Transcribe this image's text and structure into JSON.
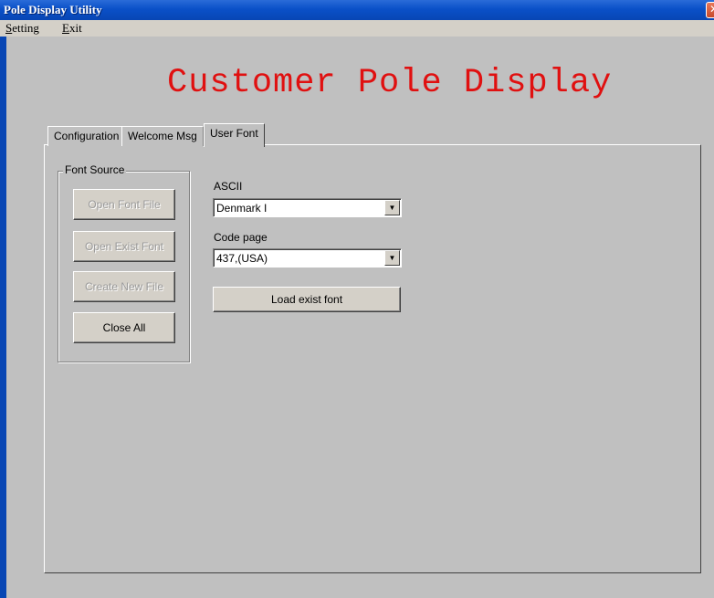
{
  "window": {
    "title": "Pole Display Utility",
    "close_glyph": "✕"
  },
  "menu": [
    {
      "accel": "S",
      "rest": "etting"
    },
    {
      "accel": "E",
      "rest": "xit"
    }
  ],
  "heading": "Customer Pole Display",
  "tabs": [
    {
      "label": "Configuration"
    },
    {
      "label": "Welcome Msg"
    },
    {
      "label": "User Font",
      "active": true
    }
  ],
  "font_source": {
    "label": "Font Source",
    "buttons": [
      {
        "label": "Open Font File",
        "enabled": false
      },
      {
        "label": "Open Exist Font",
        "enabled": false
      },
      {
        "label": "Create New File",
        "enabled": false
      },
      {
        "label": "Close All",
        "enabled": true
      }
    ]
  },
  "ascii": {
    "label": "ASCII",
    "value": "Denmark I"
  },
  "code_page": {
    "label": "Code page",
    "value": "437,(USA)"
  },
  "load_button": {
    "label": "Load exist font"
  },
  "icons": {
    "dropdown_arrow": "▼"
  },
  "colors": {
    "title_bar": "#0a50c8",
    "heading": "#e01010",
    "face": "#c0c0c0"
  }
}
